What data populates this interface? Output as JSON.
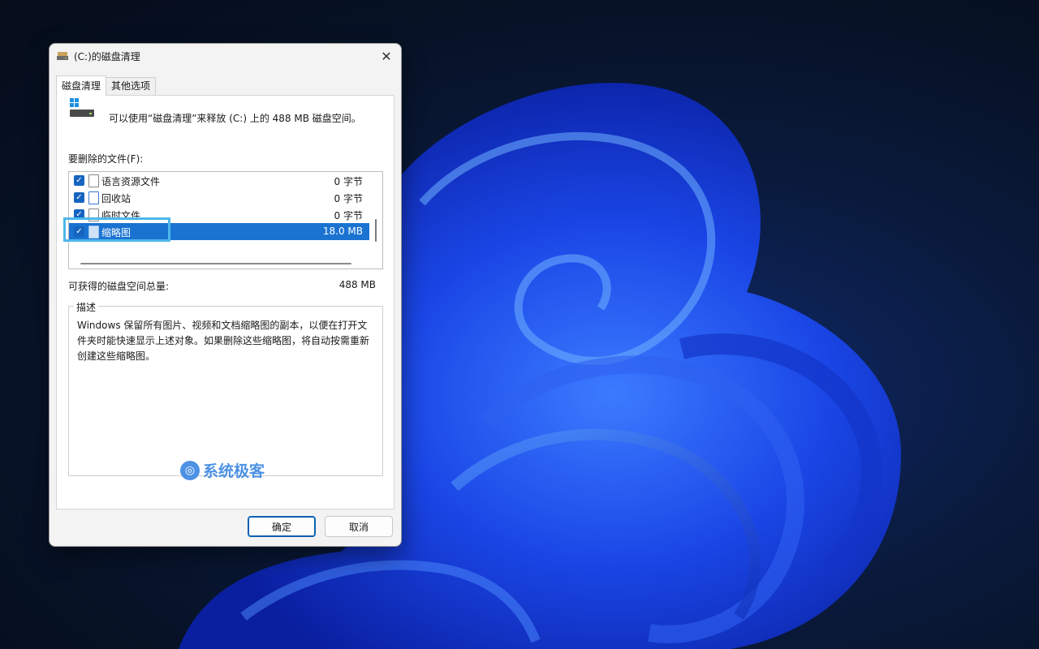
{
  "window": {
    "title": "(C:)的磁盘清理",
    "close_icon": "close-icon"
  },
  "tabs": [
    {
      "label": "磁盘清理",
      "active": true
    },
    {
      "label": "其他选项",
      "active": false
    }
  ],
  "info_text": "可以使用“磁盘清理”来释放  (C:) 上的 488 MB 磁盘空间。",
  "files_label": "要删除的文件(F):",
  "files": [
    {
      "name": "语言资源文件",
      "size": "0 字节",
      "checked": true,
      "icon": "file-icon"
    },
    {
      "name": "回收站",
      "size": "0 字节",
      "checked": true,
      "icon": "recycle-bin-icon"
    },
    {
      "name": "临时文件",
      "size": "0 字节",
      "checked": true,
      "icon": "file-icon"
    },
    {
      "name": "缩略图",
      "size": "18.0 MB",
      "checked": true,
      "icon": "file-icon",
      "selected": true
    }
  ],
  "gain": {
    "label": "可获得的磁盘空间总量:",
    "value": "488 MB"
  },
  "description": {
    "title": "描述",
    "text": "Windows 保留所有图片、视频和文档缩略图的副本，以便在打开文件夹时能快速显示上述对象。如果删除这些缩略图，将自动按需重新创建这些缩略图。"
  },
  "watermark": "系统极客",
  "buttons": {
    "ok": "确定",
    "cancel": "取消"
  },
  "colors": {
    "accent": "#1a73d1",
    "highlight": "#4db7ea",
    "wallpaper": "#1f4de0"
  }
}
